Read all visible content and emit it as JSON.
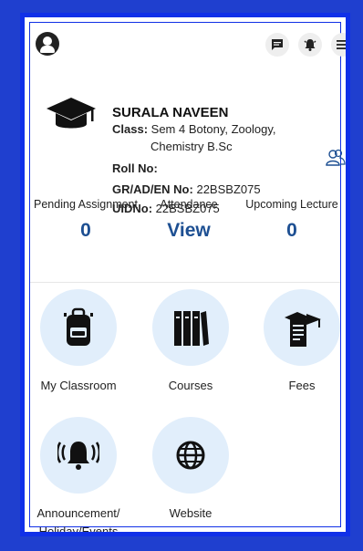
{
  "header": {
    "icons": [
      "chat-icon",
      "bell-icon",
      "menu-icon"
    ]
  },
  "profile": {
    "name": "SURALA NAVEEN",
    "class_label": "Class:",
    "class_value": "Sem 4 Botony, Zoology,",
    "class_value_2": "Chemistry B.Sc",
    "roll_label": "Roll No:",
    "gr_label": "GR/AD/EN No:",
    "gr_value": "22BSBZ075",
    "uid_label": "UIDNo:",
    "uid_value": "22BSBZ075"
  },
  "stats": [
    {
      "label": "Pending Assignment",
      "value": "0"
    },
    {
      "label": "Attendance",
      "value": "View"
    },
    {
      "label": "Upcoming Lecture",
      "value": "0"
    }
  ],
  "tiles": [
    {
      "label": "My Classroom"
    },
    {
      "label": "Courses"
    },
    {
      "label": "Fees"
    },
    {
      "label": "Announcement/",
      "label2": "Holiday/Events"
    },
    {
      "label": "Website"
    }
  ],
  "colors": {
    "frame": "#1030e8",
    "accent": "#1d4f92",
    "tile_bg": "#e1eefb"
  }
}
